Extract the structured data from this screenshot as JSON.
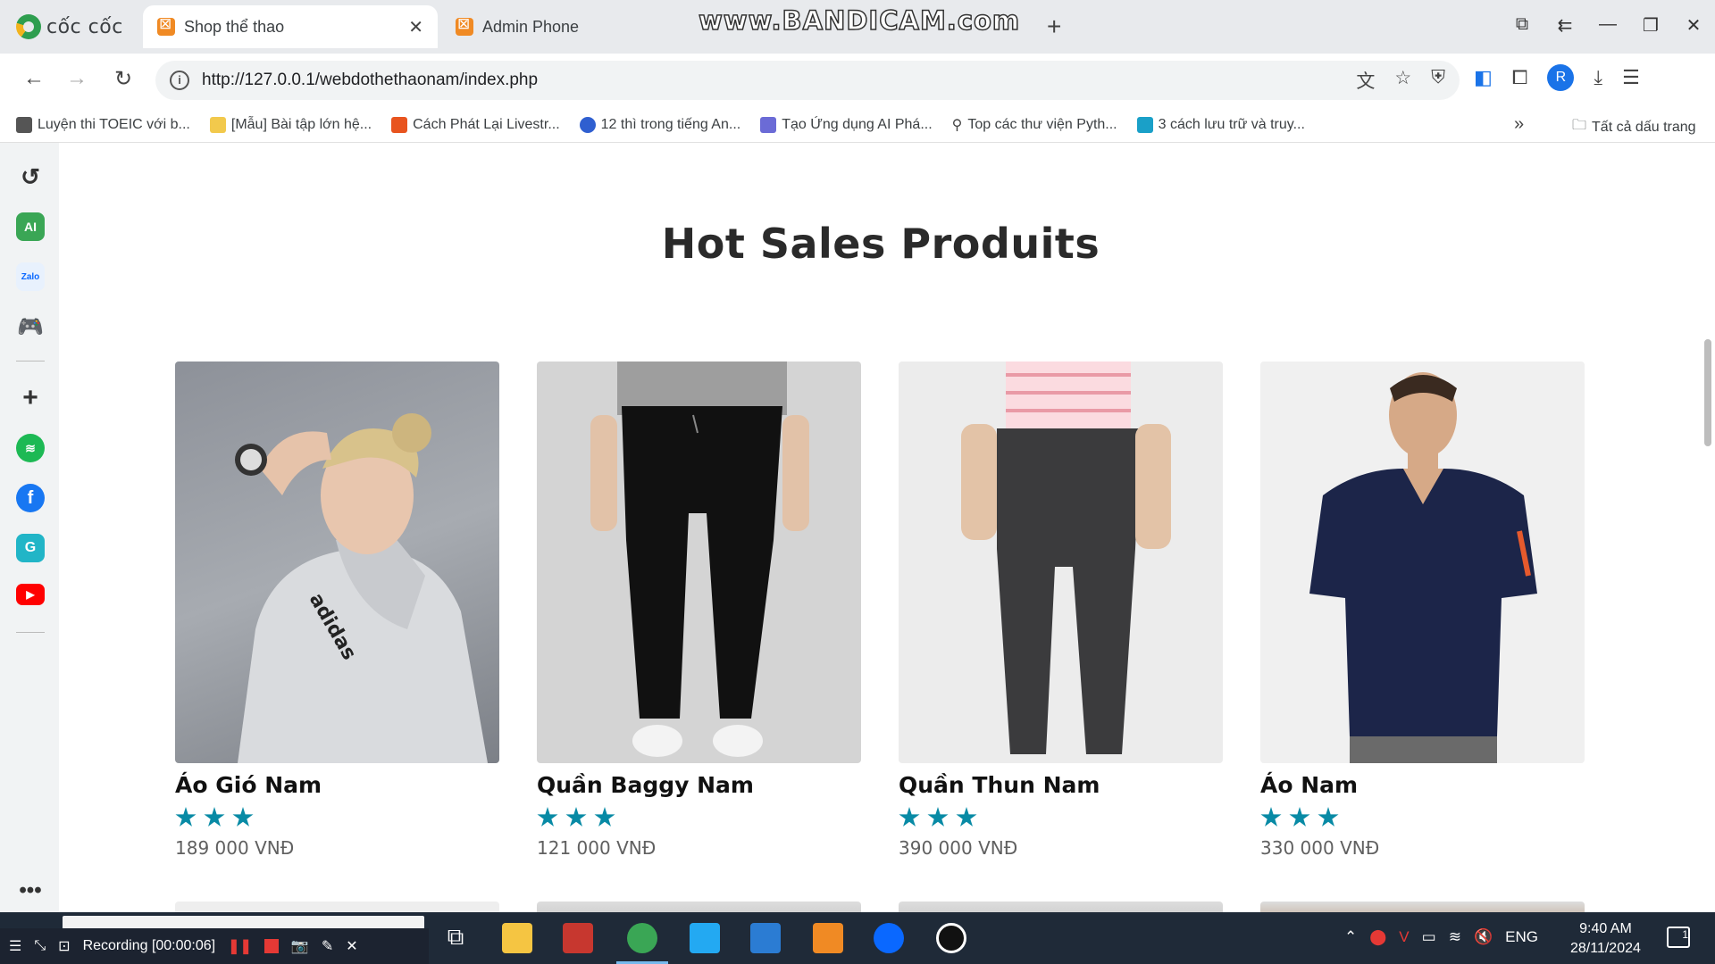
{
  "browser": {
    "brand": "cốc cốc",
    "tabs": [
      {
        "title": "Shop thể thao",
        "active": true
      },
      {
        "title": "Admin Phone",
        "active": false
      }
    ],
    "watermark": "www.BANDICAM.com",
    "url": "http://127.0.0.1/webdothethaonam/index.php",
    "profile_initial": "R"
  },
  "bookmarks": [
    {
      "label": "Luyện thi TOEIC với b...",
      "color": "#555555"
    },
    {
      "label": "[Mẫu] Bài tập lớn hệ...",
      "color": "#f2c94c"
    },
    {
      "label": "Cách Phát Lại Livestr...",
      "color": "#e8541f"
    },
    {
      "label": "12 thì trong tiếng An...",
      "color": "#2f5fd0"
    },
    {
      "label": "Tạo Ứng dụng AI Phá...",
      "color": "#6b6bd6"
    },
    {
      "label": "Top các thư viện Pyth...",
      "color": "#444444"
    },
    {
      "label": "3 cách lưu trữ và truy...",
      "color": "#1aa0c8"
    }
  ],
  "bookmarks_all": "Tất cả dấu trang",
  "page": {
    "section_title": "Hot Sales Produits",
    "products": [
      {
        "name": "Áo Gió Nam",
        "rating": 3,
        "price": "189 000 VNĐ"
      },
      {
        "name": "Quần Baggy Nam",
        "rating": 3,
        "price": "121 000 VNĐ"
      },
      {
        "name": "Quần Thun Nam",
        "rating": 3,
        "price": "390 000 VNĐ"
      },
      {
        "name": "Áo Nam",
        "rating": 3,
        "price": "330 000 VNĐ"
      }
    ]
  },
  "taskbar": {
    "recording": "Recording [00:00:06]",
    "language": "ENG",
    "time": "9:40 AM",
    "date": "28/11/2024",
    "notif_count": "1"
  },
  "colors": {
    "star": "#088aa5",
    "title": "#2a2a2a"
  }
}
